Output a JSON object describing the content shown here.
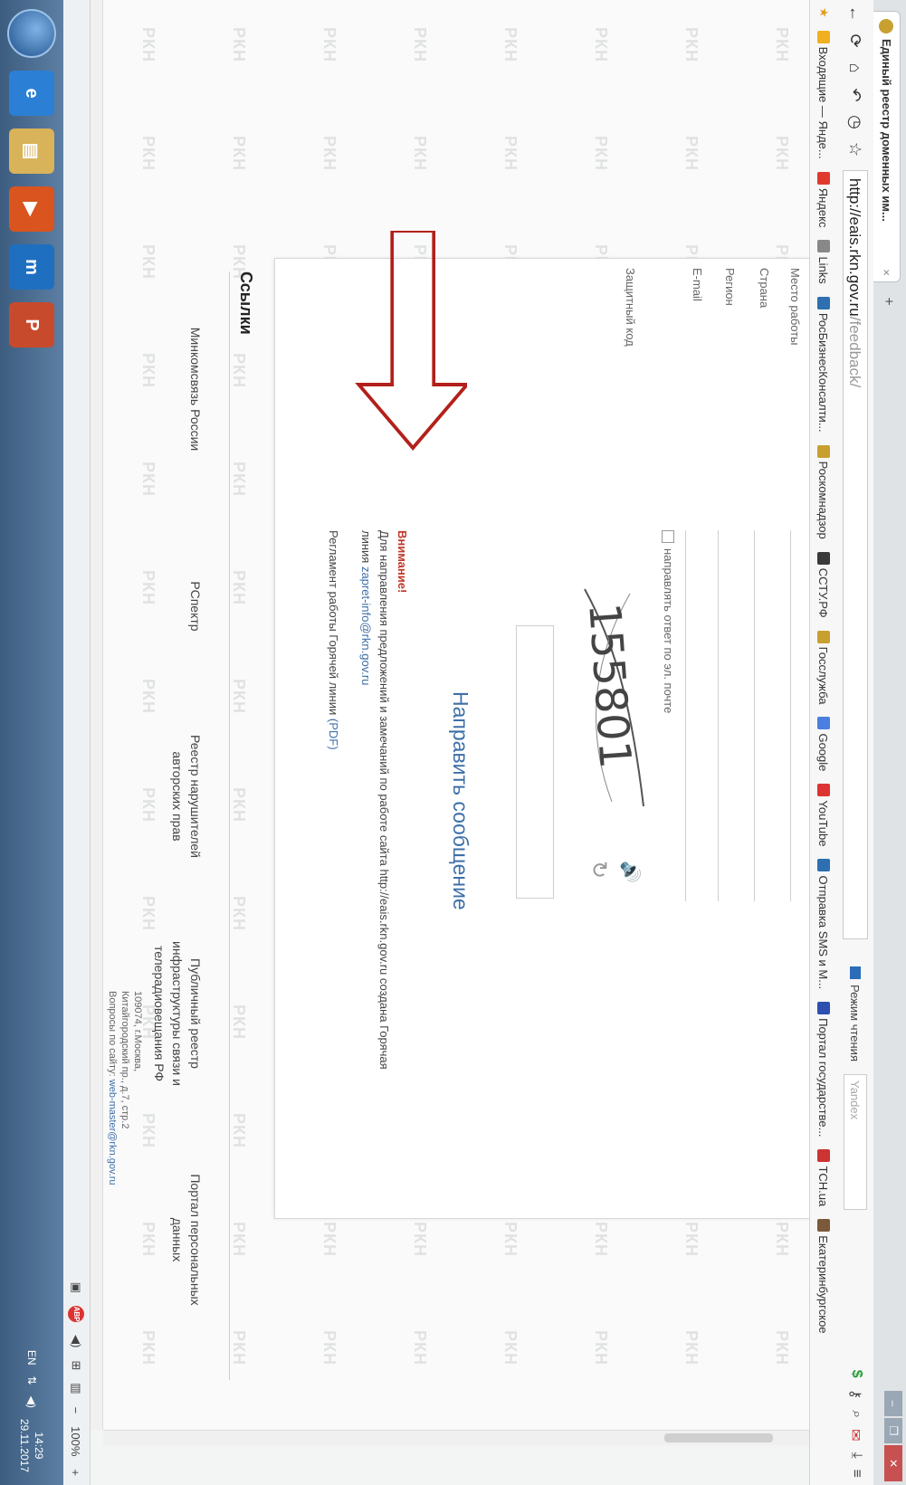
{
  "browser": {
    "tab_title": "Единый реестр доменных им...",
    "tab_close": "×",
    "new_tab": "+",
    "url_host": "http://eais.rkn.gov.ru",
    "url_path": "/feedback/",
    "reader_mode": "Режим чтения",
    "search_placeholder": "Yandex",
    "bookmarks": [
      {
        "label": "Входящие — Янде...",
        "color": "#f0b020"
      },
      {
        "label": "Яндекс",
        "color": "#e03a2f"
      },
      {
        "label": "Links",
        "color": "#888888"
      },
      {
        "label": "РосБизнесКонсалти...",
        "color": "#2d6fb0"
      },
      {
        "label": "Роскомнадзор",
        "color": "#c8a030"
      },
      {
        "label": "ССТУ.РФ",
        "color": "#3a3a3a"
      },
      {
        "label": "Госслужба",
        "color": "#c8a030"
      },
      {
        "label": "Google",
        "color": "#4a7fe0"
      },
      {
        "label": "YouTube",
        "color": "#d33"
      },
      {
        "label": "Отправка SMS и М...",
        "color": "#2d6fb0"
      },
      {
        "label": "Портал государстве...",
        "color": "#2d4fb0"
      },
      {
        "label": "TCH.ua",
        "color": "#c33"
      },
      {
        "label": "Екатеринбургское",
        "color": "#7a5a3a"
      }
    ]
  },
  "form": {
    "label_workplace": "Место работы",
    "label_country": "Страна",
    "label_region": "Регион",
    "label_email": "E-mail",
    "checkbox_label": "направлять ответ по эл. почте",
    "label_code": "Защитный код",
    "captcha_text": "155801",
    "submit_label": "Направить сообщение"
  },
  "notice": {
    "head": "Внимание!",
    "text_1": "Для направления предложений и замечаний по работе сайта http://eais.rkn.gov.ru создана Горячая",
    "text_2": "линия",
    "email": "zapret-info@rkn.gov.ru",
    "reglament": "Регламент работы Горячей линии",
    "pdf": "(PDF)"
  },
  "links": {
    "title": "Ссылки",
    "items": [
      "Минкомсвязь России",
      "РСпектр",
      "Реестр нарушителей авторских прав",
      "Публичный реестр инфраструктуры связи и телерадиовещания РФ",
      "Портал персональных данных"
    ],
    "address_1": "109074, г.Москва,",
    "address_2": "Китайгородский пр., д.7, стр.2",
    "address_3": "Вопросы по сайту:",
    "address_email": "web-master@rkn.gov.ru"
  },
  "watermark": "РКН",
  "status": {
    "zoom": "100%",
    "adp": "ABP"
  },
  "taskbar": {
    "lang": "EN",
    "time": "14:29",
    "date": "29.11.2017"
  }
}
